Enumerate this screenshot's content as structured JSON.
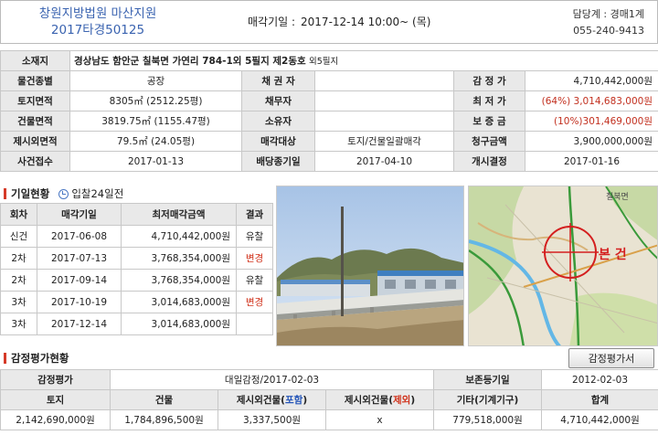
{
  "header": {
    "court": "창원지방법원 마산지원",
    "case_no": "2017타경50125",
    "sale_label": "매각기일 :",
    "sale_date": "2017-12-14   10:00~ (목)",
    "dept": "담당계 : 경매1계",
    "phone": "055-240-9413"
  },
  "info": {
    "location_label": "소재지",
    "location": "경상남도 함안군 칠북면 가연리 784-1외 5필지 제2동호",
    "location_extra": "외5필지",
    "rows": [
      {
        "l1": "물건종별",
        "v1": "공장",
        "l2": "채 권 자",
        "v2": "",
        "l3": "감 정 가",
        "v3": "4,710,442,000원"
      },
      {
        "l1": "토지면적",
        "v1": "8305㎡ (2512.25평)",
        "l2": "채무자",
        "v2": "",
        "l3": "최 저 가",
        "v3": "(64%) 3,014,683,000원"
      },
      {
        "l1": "건물면적",
        "v1": "3819.75㎡ (1155.47평)",
        "l2": "소유자",
        "v2": "",
        "l3": "보 증 금",
        "v3": "(10%)301,469,000원"
      },
      {
        "l1": "제시외면적",
        "v1": "79.5㎡ (24.05평)",
        "l2": "매각대상",
        "v2": "토지/건물일괄매각",
        "l3": "청구금액",
        "v3": "3,900,000,000원"
      },
      {
        "l1": "사건접수",
        "v1": "2017-01-13",
        "l2": "배당종기일",
        "v2": "2017-04-10",
        "l3": "개시결정",
        "v3": "2017-01-16"
      }
    ]
  },
  "bids": {
    "title": "기일현황",
    "tender_text": "입찰24일전",
    "headers": [
      "회차",
      "매각기일",
      "최저매각금액",
      "결과"
    ],
    "rows": [
      {
        "round": "신건",
        "date": "2017-06-08",
        "price": "4,710,442,000원",
        "result": "유찰",
        "changed": false
      },
      {
        "round": "2차",
        "date": "2017-07-13",
        "price": "3,768,354,000원",
        "result": "변경",
        "changed": true
      },
      {
        "round": "2차",
        "date": "2017-09-14",
        "price": "3,768,354,000원",
        "result": "유찰",
        "changed": false
      },
      {
        "round": "3차",
        "date": "2017-10-19",
        "price": "3,014,683,000원",
        "result": "변경",
        "changed": true
      },
      {
        "round": "3차",
        "date": "2017-12-14",
        "price": "3,014,683,000원",
        "result": "",
        "changed": false
      }
    ]
  },
  "map": {
    "place_label": "칠북면",
    "marker_label": "본 건"
  },
  "appraisal": {
    "title": "감정평가현황",
    "button": "감정평가서",
    "row1": {
      "l1": "감정평가",
      "v1": "대일감정/2017-02-03",
      "l2": "보존등기일",
      "v2": "2012-02-03"
    },
    "headers": [
      "토지",
      "건물",
      "제시외건물(",
      "포함",
      ")",
      "제시외건물(",
      "제외",
      ")",
      "기타(기계기구)",
      "합계"
    ],
    "values": [
      "2,142,690,000원",
      "1,784,896,500원",
      "3,337,500원",
      "x",
      "779,518,000원",
      "4,710,442,000원"
    ]
  }
}
